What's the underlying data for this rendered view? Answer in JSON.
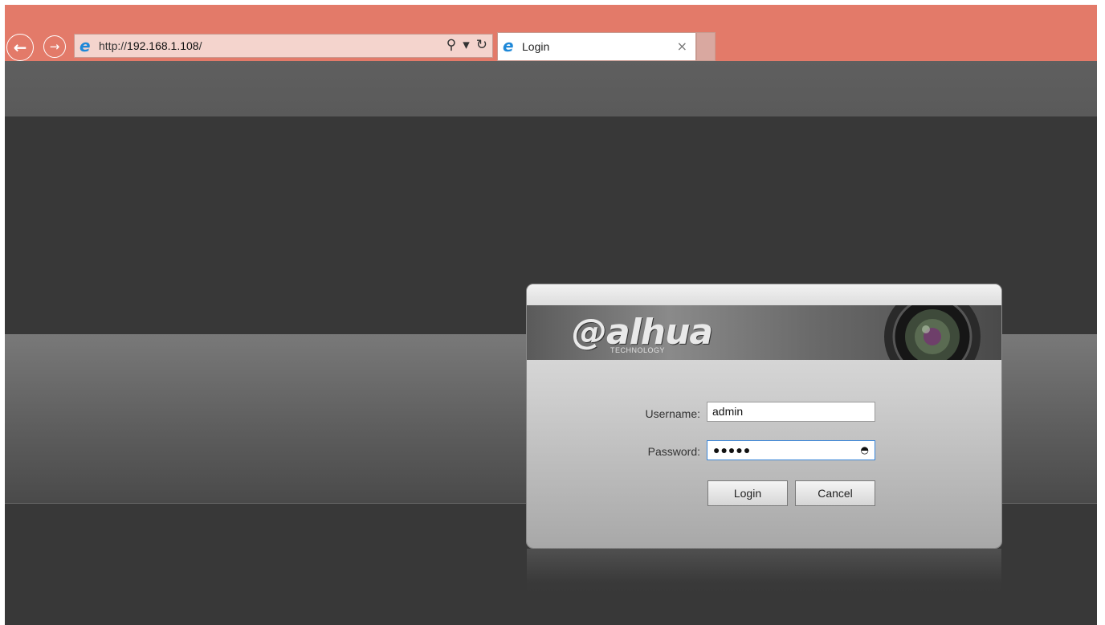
{
  "browser": {
    "url_prefix": "http://",
    "url_host": "192.168.1.108",
    "url_suffix": "/",
    "search_icon": "⚲",
    "dropdown_icon": "▾",
    "refresh_icon": "↻",
    "tab_title": "Login",
    "tab_close": "×",
    "back_icon": "←",
    "forward_icon": "→",
    "accent_color": "#e37a69"
  },
  "login": {
    "brand": "alhua",
    "brand_sub": "TECHNOLOGY",
    "username_label": "Username:",
    "username_value": "admin",
    "password_label": "Password:",
    "password_mask": "●●●●●",
    "eye_icon": "◓",
    "login_button": "Login",
    "cancel_button": "Cancel"
  }
}
